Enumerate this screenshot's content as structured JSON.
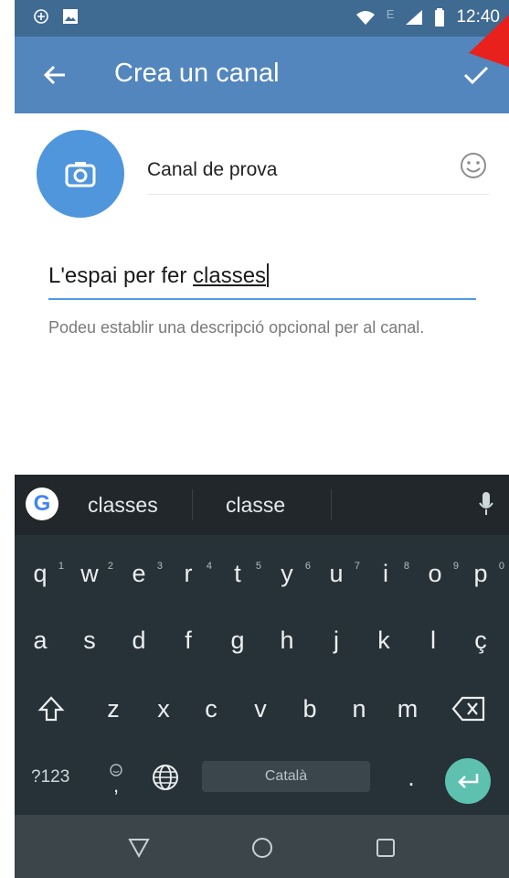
{
  "status_bar": {
    "time": "12:40",
    "network_letter": "E"
  },
  "app_bar": {
    "title": "Crea un canal"
  },
  "channel_name": {
    "value": "Canal de prova"
  },
  "description": {
    "value_prefix": "L'espai per fer ",
    "value_underlined": "classes",
    "hint": "Podeu establir una descripció opcional per al canal."
  },
  "keyboard": {
    "suggestions": [
      "classes",
      "classe"
    ],
    "row1": [
      {
        "k": "q",
        "n": "1"
      },
      {
        "k": "w",
        "n": "2"
      },
      {
        "k": "e",
        "n": "3"
      },
      {
        "k": "r",
        "n": "4"
      },
      {
        "k": "t",
        "n": "5"
      },
      {
        "k": "y",
        "n": "6"
      },
      {
        "k": "u",
        "n": "7"
      },
      {
        "k": "i",
        "n": "8"
      },
      {
        "k": "o",
        "n": "9"
      },
      {
        "k": "p",
        "n": "0"
      }
    ],
    "row2": [
      "a",
      "s",
      "d",
      "f",
      "g",
      "h",
      "j",
      "k",
      "l",
      "ç"
    ],
    "row3": [
      "z",
      "x",
      "c",
      "v",
      "b",
      "n",
      "m"
    ],
    "symbols_label": "?123",
    "comma_label": ",",
    "space_label": "Català",
    "period_label": "."
  },
  "colors": {
    "app_bar": "#5386bd",
    "status_bar": "#3f6a92",
    "avatar": "#4f96dd",
    "accent_underline": "#4d9be1",
    "enter": "#5ec1b0",
    "keyboard_bg": "#263238"
  },
  "icons": [
    "back-arrow-icon",
    "check-icon",
    "camera-icon",
    "emoji-icon",
    "google-icon",
    "mic-icon",
    "shift-icon",
    "backspace-icon",
    "emoji-key-icon",
    "globe-icon",
    "enter-icon",
    "nav-back-icon",
    "nav-home-icon",
    "nav-recents-icon"
  ]
}
